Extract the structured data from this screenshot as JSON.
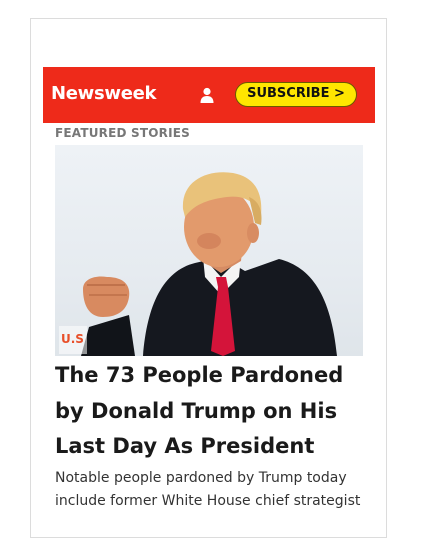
{
  "header": {
    "logo": "Newsweek",
    "subscribe_label": "SUBSCRIBE >"
  },
  "colors": {
    "header_bg": "#ee2a1a",
    "subscribe_bg": "#ffe600",
    "category_tag": "#e8502a"
  },
  "icons": {
    "account": "user-icon"
  },
  "featured": {
    "section_label": "FEATURED STORIES",
    "category": "U.S",
    "headline": "The 73 People Pardoned by Donald Trump on His Last Day As President",
    "summary": "Notable people pardoned by Trump today include former White House chief strategist"
  }
}
